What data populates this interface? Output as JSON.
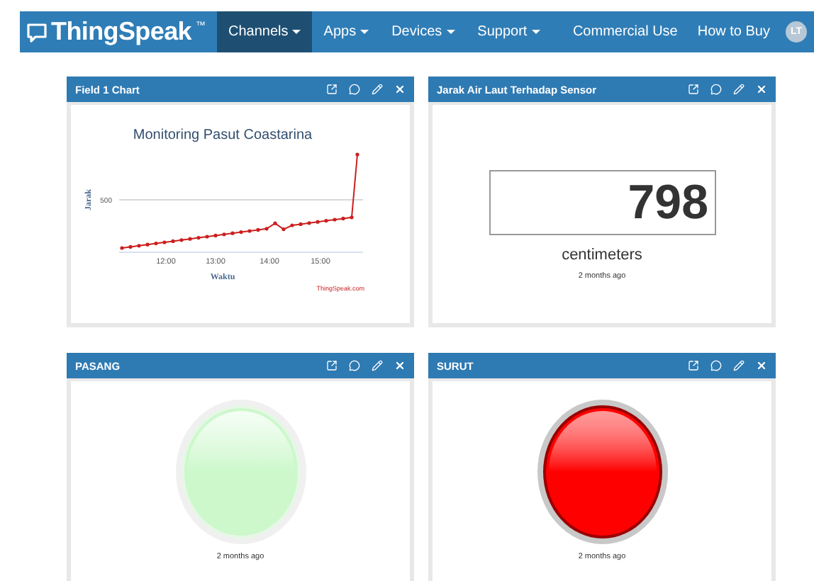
{
  "navbar": {
    "brand": "ThingSpeak",
    "trademark": "™",
    "menus": [
      {
        "label": "Channels",
        "selected": true
      },
      {
        "label": "Apps",
        "selected": false
      },
      {
        "label": "Devices",
        "selected": false
      },
      {
        "label": "Support",
        "selected": false
      }
    ],
    "links": [
      "Commercial Use",
      "How to Buy"
    ],
    "avatar": "LT"
  },
  "widgets": [
    {
      "kind": "chart",
      "title": "Field 1 Chart",
      "chart_title": "Monitoring Pasut Coastarina",
      "ylabel": "Jarak",
      "ytick": "500",
      "xticks": [
        "12:00",
        "13:00",
        "14:00",
        "15:00"
      ],
      "xlabel": "Waktu",
      "credit": "ThingSpeak.com"
    },
    {
      "kind": "numeric",
      "title": "Jarak Air Laut Terhadap Sensor",
      "value": "798",
      "unit": "centimeters",
      "updated": "2 months ago"
    },
    {
      "kind": "lamp",
      "title": "PASANG",
      "on": false,
      "color": "#ccf8cc",
      "updated": "2 months ago"
    },
    {
      "kind": "lamp",
      "title": "SURUT",
      "on": true,
      "color": "#ff0000",
      "updated": "2 months ago"
    }
  ]
}
